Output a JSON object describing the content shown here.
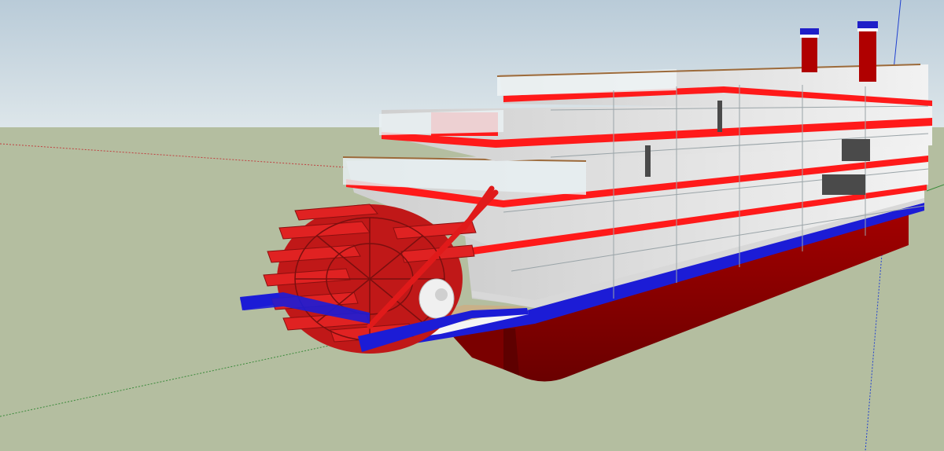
{
  "viewport": {
    "mode": "3d-model-view",
    "model": "sternwheel-riverboat",
    "decks": 4,
    "smokestacks": 2,
    "paddlewheel": "stern",
    "axes": [
      "red-axis",
      "green-axis",
      "blue-axis"
    ]
  },
  "colors": {
    "sky_top": "#b9cbd8",
    "sky_bottom": "#dde6ea",
    "ground": "#b4bea0",
    "hull": "#8b0000",
    "hull_dark": "#5e0000",
    "deck_trim_red": "#ff1a1a",
    "waterline_blue": "#1c1cd6",
    "superstructure": "#e4e4e4",
    "wood_deck": "#c9b088",
    "paddlewheel": "#d42020"
  }
}
